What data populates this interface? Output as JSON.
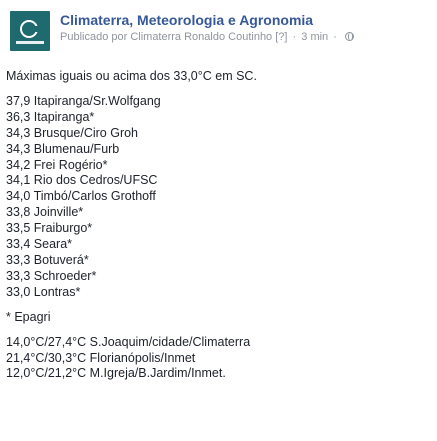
{
  "post": {
    "page_name": "Climaterra, Meteorologia e Agronomia",
    "published_by": "Publicado por Climaterra Ronaldo Coutinho [?]",
    "time": "3 min",
    "separator": "·",
    "audience_icon": "globe-icon",
    "intro": "Máximas iguais ou acima dos 33,0°C em SC.",
    "stations": [
      "37,9 Itapiranga/Sr.Wolfgang",
      "36,3 Itapiranga*",
      "34,3 Brusque/Ciro Groh",
      "34,3 Blumenau/Furb",
      "34,2 Frei Rogério*",
      "34,1 Rio dos Cedros/UFSC",
      "34,0 Timbó/Carlos Grothoff",
      "33,8 Joinville*",
      "33,5 Fraiburgo*",
      "33,4 Seara*",
      "33,3 Botuverá*",
      "33,3 Schroeder*",
      "33,0 Lontras*"
    ],
    "footnote": "* Epagri",
    "extremes": [
      "14,0°C/27,4°C S.Joaquim/cidade/Climaterra",
      "21,4°C/30,3°C Florianópolis/Inmet",
      "12,0°C/21,2°C M.Igreja/B.Jardim/Inmet."
    ]
  },
  "colors": {
    "link": "#365899",
    "meta": "#90949c",
    "text": "#1d2129",
    "avatar_bg": "#1f6a6f"
  }
}
